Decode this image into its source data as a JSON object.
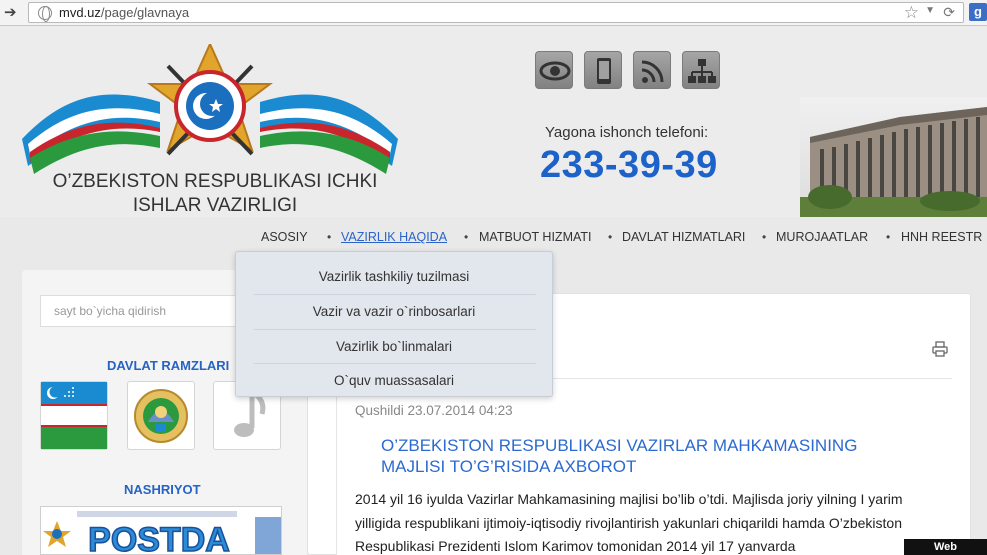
{
  "browser": {
    "url_domain": "mvd.uz",
    "url_path": "/page/glavnaya",
    "google_button": "g"
  },
  "header": {
    "site_name_line1": "O’ZBEKISTON RESPUBLIKASI ICHKI",
    "site_name_line2": "ISHLAR VAZIRLIGI",
    "hotline_label": "Yagona ishonch telefoni:",
    "hotline_number": "233-39-39",
    "icons": [
      "eye-icon",
      "mobile-icon",
      "rss-icon",
      "sitemap-icon"
    ],
    "colors": {
      "hotline": "#1d62c9",
      "accent": "#2b63c9"
    }
  },
  "nav": {
    "items": [
      "ASOSIY",
      "VAZIRLIK HAQIDA",
      "MATBUOT HIZMATI",
      "DAVLAT HIZMATLARI",
      "MUROJAATLAR",
      "HNH REESTR"
    ],
    "active": "VAZIRLIK HAQIDA"
  },
  "dropdown": {
    "items": [
      "Vazirlik tashkiliy tuzilmasi",
      "Vazir va vazir o`rinbosarlari",
      "Vazirlik bo`linmalari",
      "O`quv muassasalari"
    ]
  },
  "sidebar": {
    "search_placeholder": "sayt bo`yicha qidirish",
    "symbols_title": "DAVLAT RAMZLARI",
    "publisher_title": "NASHRIYOT",
    "postda": "POSTDA"
  },
  "article": {
    "date": "Qushildi 23.07.2014 04:23",
    "title": "O’ZBEKISTON RESPUBLIKASI VAZIRLAR MAHKAMASINING MAJLISI TO’G’RISIDA AXBOROT",
    "body": "2014 yil 16 iyulda Vazirlar Mahkamasining majlisi bo’lib o’tdi. Majlisda joriy yilning I yarim yilligida respublikani ijtimoiy-iqtisodiy rivojlantirish yakunlari chiqarildi hamda O’zbekiston Respublikasi Prezidenti Islom Karimov tomonidan 2014 yil 17 yanvarda"
  },
  "watermark": "Web Screenshot"
}
